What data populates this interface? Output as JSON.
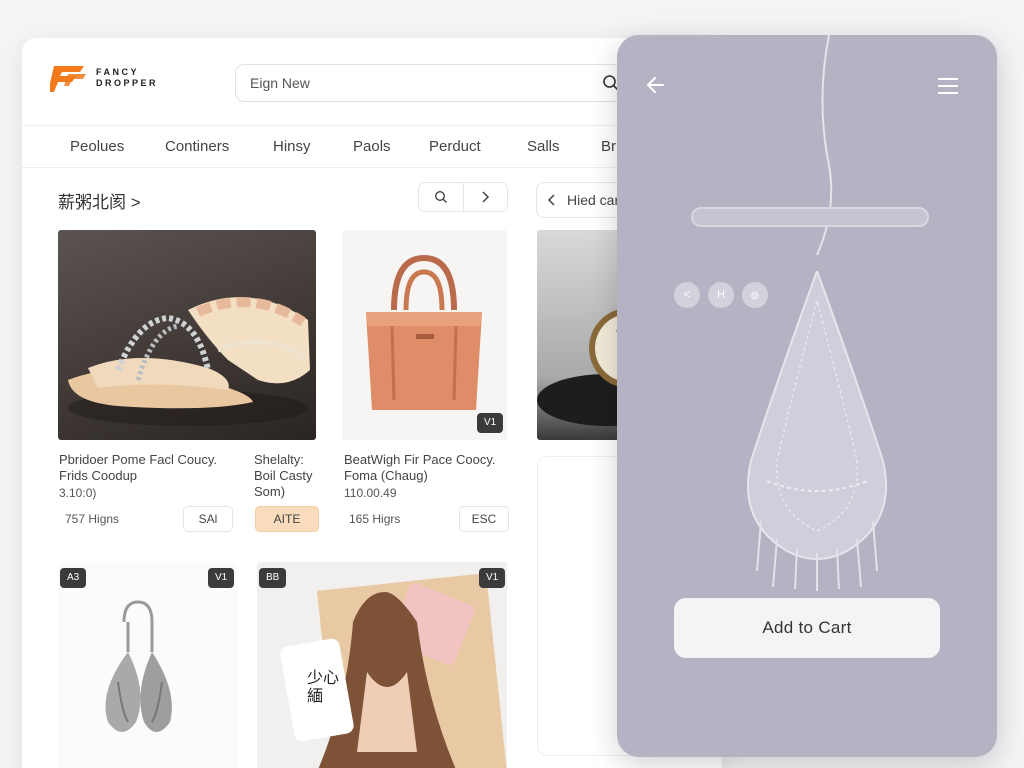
{
  "brand": {
    "line1": "FANCY",
    "line2": "DROPPER"
  },
  "search": {
    "text": "Eign New"
  },
  "nav": [
    "Peolues",
    "Continers",
    "Hinsy",
    "Paols",
    "Perduct",
    "Salls",
    "Br"
  ],
  "section": {
    "title": "薪粥北阂 >"
  },
  "hired": {
    "label": "Hied car"
  },
  "products": [
    {
      "title_line1": "Pbridoer Pome Facl Coucy.",
      "title_line2": "Frids Coodup",
      "price": "3.10:0)",
      "footer": "757 Higns",
      "tag": "SAl"
    },
    {
      "title_line1": "Shelalty:",
      "title_line2": "Boil Casty",
      "title_line3": "Som)",
      "tag": "AITE"
    },
    {
      "title_line1": "BeatWigh Fir Pace Coocy.",
      "title_line2": "Foma (Chaug)",
      "price": "110.00.49",
      "footer": "165 Higrs",
      "tag": "ESC",
      "badge": "V1"
    }
  ],
  "badges": {
    "earring_left": "A3",
    "earring_right": "V1",
    "poster_left": "BB",
    "poster_right": "V1"
  },
  "poster": {
    "bag_text": "少心\n緬"
  },
  "phone": {
    "circles": [
      "<",
      "H",
      "⊚"
    ],
    "cart_button": "Add to Cart"
  },
  "colors": {
    "accent": "#f27a1a",
    "phone_bg": "#b5b3c3",
    "tag_highlight": "#f8dcbc"
  }
}
